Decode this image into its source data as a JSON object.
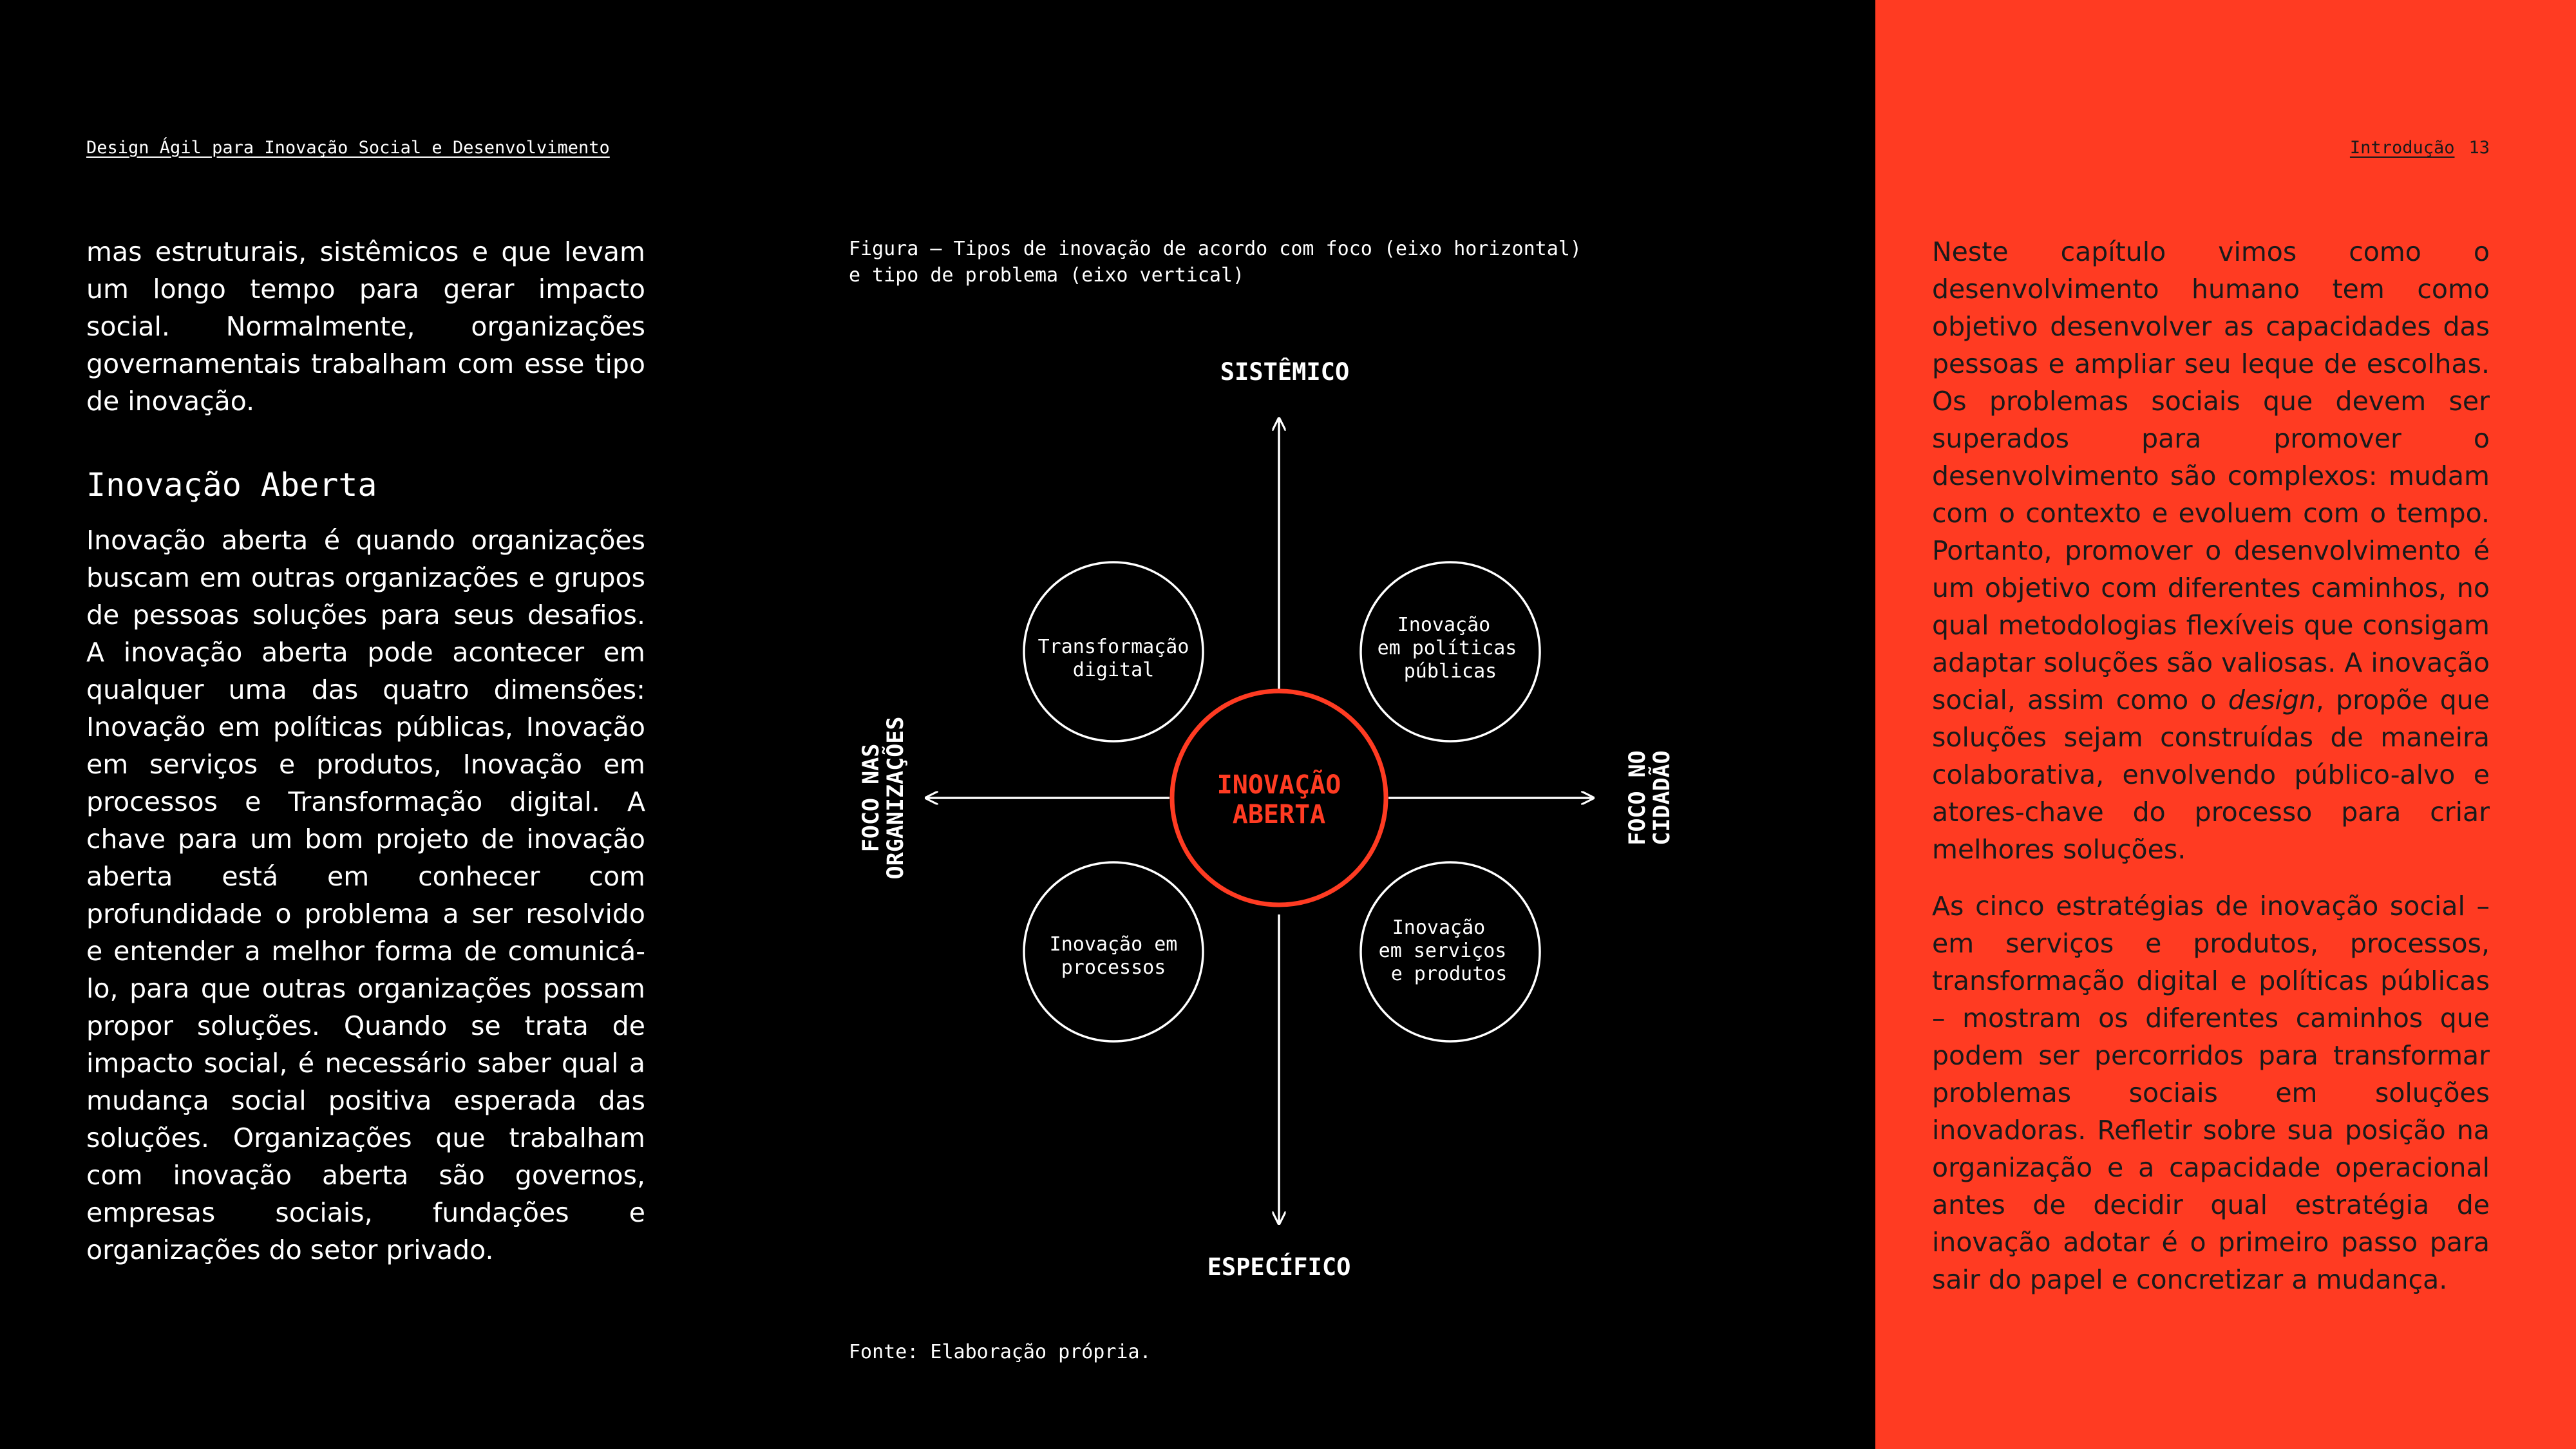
{
  "header": {
    "book_title": "Design Ágil para Inovação Social e Desenvolvimento",
    "section": "Introdução",
    "page_number": "13"
  },
  "left_column": {
    "paragraph_1": "mas estruturais, sistêmicos e que levam um longo tempo para gerar impacto social. Normalmente, organizações governamentais trabalham com esse tipo de inovação.",
    "heading": "Inovação Aberta",
    "paragraph_2": "Inovação aberta é quando organizações buscam em outras organizações e grupos de pessoas soluções para seus desafios. A inovação aberta pode acontecer em qualquer uma das quatro dimensões: Inovação em políticas públicas, Inovação em serviços e produtos, Inovação em processos e Transformação digital. A chave para um bom projeto de inovação aberta está em conhecer com profundidade o problema a ser resolvido e entender a melhor forma de comunicá-lo, para que outras organizações possam propor soluções. Quando se trata de impacto social, é necessário saber qual a mudança social positiva esperada das soluções. Organizações que trabalham com inovação aberta são governos, empresas sociais, fundações e organizações do setor privado."
  },
  "figure": {
    "caption": "Figura – Tipos de inovação de acordo com foco (eixo horizontal)\ne tipo de problema (eixo vertical)",
    "source": "Fonte: Elaboração própria.",
    "axis_top": "SISTÊMICO",
    "axis_bottom": "ESPECÍFICO",
    "axis_left": [
      "FOCO NAS",
      "ORGANIZAÇÕES"
    ],
    "axis_right": [
      "FOCO NO",
      "CIDADÃO"
    ],
    "center": [
      "INOVAÇÃO",
      "ABERTA"
    ],
    "top_left": [
      "Transformação",
      "digital"
    ],
    "top_right": [
      "Inovação",
      "em políticas",
      "públicas"
    ],
    "bottom_left": [
      "Inovação em",
      "processos"
    ],
    "bottom_right": [
      "Inovação",
      "em serviços",
      "e produtos"
    ]
  },
  "right_column": {
    "paragraph_1_before": "Neste capítulo vimos como o desenvolvimento humano tem como objetivo desenvolver as capacidades das pessoas e ampliar seu leque de escolhas. Os problemas sociais que devem ser superados para promover o desenvolvimento são complexos: mudam com o contexto e evoluem com o tempo. Portanto, promover o desenvolvimento é um objetivo com diferentes caminhos, no qual metodologias flexíveis que consigam adaptar soluções são valiosas. A inovação social, assim como o ",
    "paragraph_1_em": "design",
    "paragraph_1_after": ", propõe que soluções sejam construídas de maneira colaborativa, envolvendo público-alvo e atores-chave do processo para criar melhores soluções.",
    "paragraph_2": "As cinco estratégias de inovação social – em serviços e produtos, processos, transformação digital e políticas públicas – mostram os diferentes caminhos que podem ser percorridos para transformar problemas sociais em soluções inovadoras. Refletir sobre sua posição na organização e a capacidade operacional antes de decidir qual estratégia de inovação adotar é o primeiro passo para sair do papel e concretizar a mudança."
  },
  "colors": {
    "left_background": "#000000",
    "right_background": "#ff3b22",
    "accent": "#ff3b22",
    "text_light": "#ffffff",
    "text_dark": "#1a1a1a"
  }
}
